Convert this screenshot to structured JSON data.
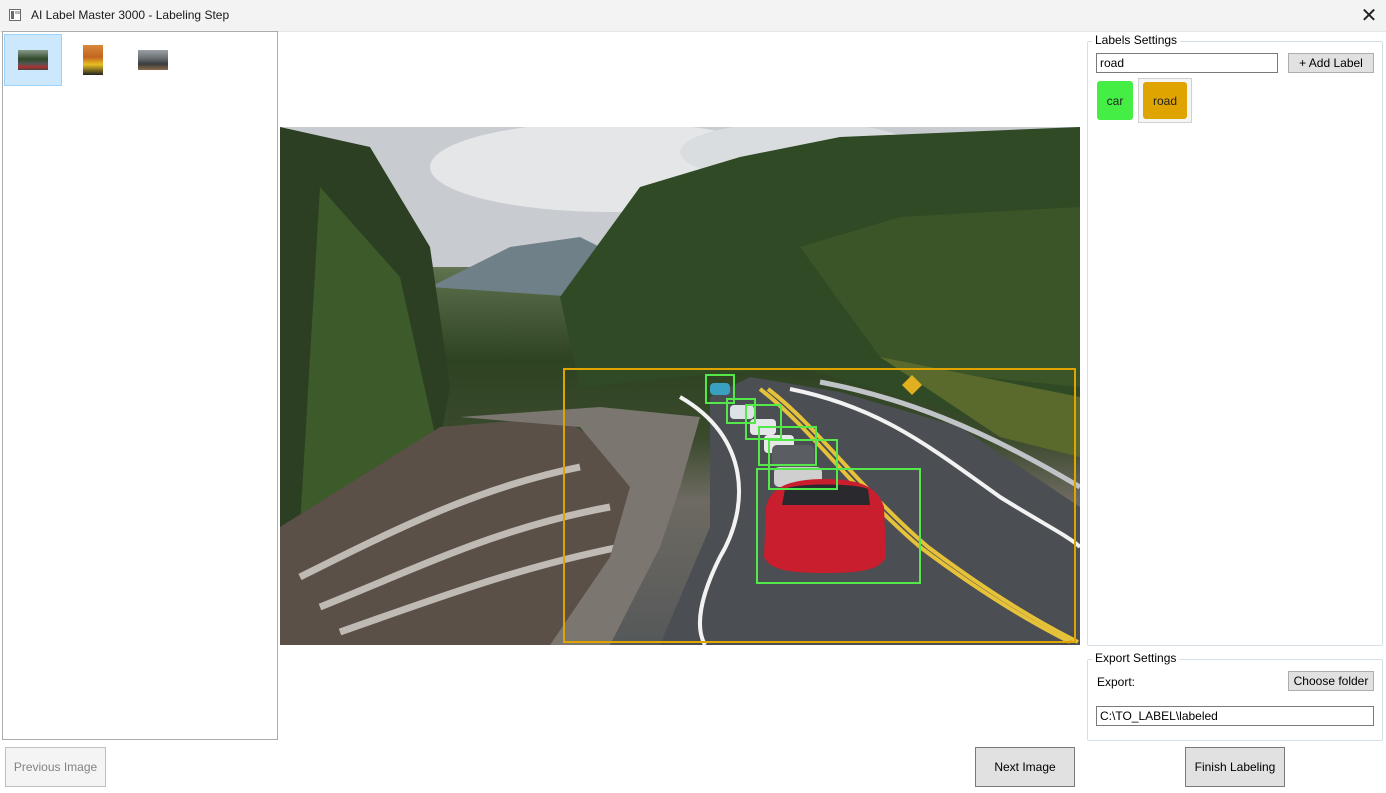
{
  "window": {
    "title": "AI Label Master 3000 - Labeling Step",
    "close_glyph": "✕"
  },
  "thumbnails": [
    {
      "name": "thumbnail-road-car",
      "selected": true
    },
    {
      "name": "thumbnail-orange",
      "selected": false
    },
    {
      "name": "thumbnail-street",
      "selected": false
    }
  ],
  "navigation": {
    "previous_label": "Previous Image",
    "next_label": "Next Image",
    "finish_label": "Finish Labeling"
  },
  "labels_settings": {
    "title": "Labels Settings",
    "input_value": "road",
    "add_button_label": "+ Add Label",
    "labels": [
      {
        "name": "car",
        "color": "#44ee44"
      },
      {
        "name": "road",
        "color": "#e0a400"
      }
    ]
  },
  "export_settings": {
    "title": "Export Settings",
    "export_label": "Export:",
    "choose_folder_label": "Choose folder",
    "path": "C:\\TO_LABEL\\labeled"
  },
  "annotations": [
    {
      "label": "road"
    },
    {
      "label": "car"
    },
    {
      "label": "car"
    },
    {
      "label": "car"
    },
    {
      "label": "car"
    },
    {
      "label": "car"
    },
    {
      "label": "car"
    }
  ]
}
